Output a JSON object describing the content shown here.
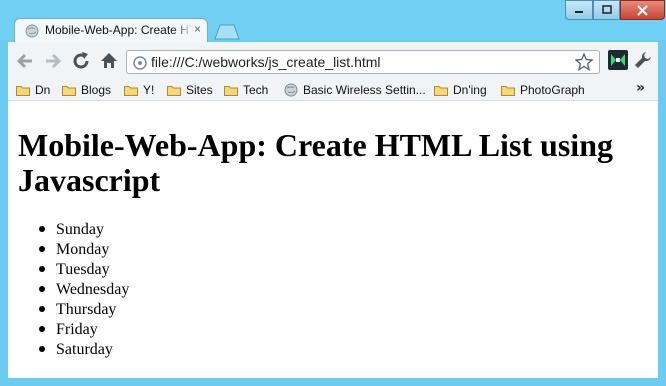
{
  "browser": {
    "tab_title": "Mobile-Web-App: Create HTML List using Javascript",
    "tab_close": "×",
    "address": "file:///C:/webworks/js_create_list.html",
    "bookmarks": [
      {
        "label": "Dn",
        "icon": "folder-icon"
      },
      {
        "label": "Blogs",
        "icon": "folder-icon"
      },
      {
        "label": "Y!",
        "icon": "folder-icon"
      },
      {
        "label": "Sites",
        "icon": "folder-icon"
      },
      {
        "label": "Tech",
        "icon": "folder-icon"
      },
      {
        "label": "Basic Wireless Settin...",
        "icon": "globe-icon"
      },
      {
        "label": "Dn'ing",
        "icon": "folder-icon"
      },
      {
        "label": "PhotoGraph",
        "icon": "folder-icon"
      }
    ],
    "bookmarks_more": "»",
    "colors": {
      "frame": "#6fd0f4",
      "close_button": "#c84533"
    }
  },
  "page": {
    "heading": "Mobile-Web-App: Create HTML List using Javascript",
    "days": [
      "Sunday",
      "Monday",
      "Tuesday",
      "Wednesday",
      "Thursday",
      "Friday",
      "Saturday"
    ]
  }
}
